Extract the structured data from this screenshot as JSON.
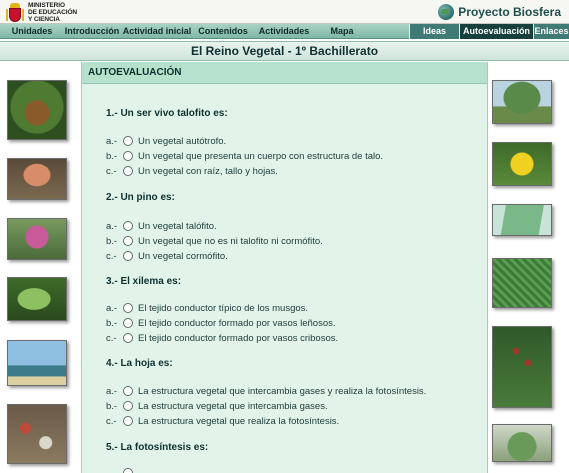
{
  "header": {
    "ministry_lines": [
      "MINISTERIO",
      "DE EDUCACIÓN",
      "Y CIENCIA"
    ],
    "brand": "Proyecto Biosfera"
  },
  "nav": {
    "items": [
      "Unidades",
      "Introducción",
      "Actividad inicial",
      "Contenidos",
      "Actividades",
      "Mapa"
    ],
    "right_items": [
      "Ideas",
      "Autoevaluación",
      "Enlaces"
    ],
    "active": "Autoevaluación"
  },
  "page_title": "El Reino Vegetal   -   1º Bachillerato",
  "section_title": "AUTOEVALUACIÓN",
  "questions": [
    {
      "text": "1.- Un ser vivo talofito es:",
      "options": [
        {
          "letter": "a.-",
          "text": "Un vegetal autótrofo."
        },
        {
          "letter": "b.-",
          "text": "Un vegetal que presenta un cuerpo con estructura de talo."
        },
        {
          "letter": "c.-",
          "text": "Un vegetal con raíz, tallo y hojas."
        }
      ]
    },
    {
      "text": "2.- Un pino es:",
      "options": [
        {
          "letter": "a.-",
          "text": "Un vegetal talófito."
        },
        {
          "letter": "b.-",
          "text": "Un vegetal que no es ni talofito ni cormófito."
        },
        {
          "letter": "c.-",
          "text": "Un vegetal cormófito."
        }
      ]
    },
    {
      "text": "3.- El xilema es:",
      "options": [
        {
          "letter": "a.-",
          "text": "El tejido conductor típico de los musgos."
        },
        {
          "letter": "b.-",
          "text": "El tejido conductor formado por vasos leñosos."
        },
        {
          "letter": "c.-",
          "text": "El tejido conductor formado por vasos cribosos."
        }
      ]
    },
    {
      "text": "4.- La hoja es:",
      "options": [
        {
          "letter": "a.-",
          "text": "La estructura vegetal que intercambia gases y realiza la fotosíntesis."
        },
        {
          "letter": "b.-",
          "text": "La estructura vegetal que intercambia gases."
        },
        {
          "letter": "c.-",
          "text": "La estructura vegetal que realiza la fotosíntesis."
        }
      ]
    },
    {
      "text": "5.- La fotosíntesis es:",
      "options": []
    }
  ],
  "left_images": [
    "pine-cone-photo",
    "mushroom-photo",
    "thistle-flower-photo",
    "plant-leaf-photo",
    "palm-trees-photo",
    "lichen-photo"
  ],
  "right_images": [
    "tree-photo",
    "yellow-flower-photo",
    "microscope-cells-photo",
    "fern-photo",
    "moss-sporophytes-photo",
    "moss-photo"
  ],
  "colors": {
    "nav_bar": "#8fc4b2",
    "nav_dark": "#3f7a74",
    "nav_active": "#173f3c",
    "content_bg": "#e2f4ea",
    "section_header_bg": "#b5e1cd",
    "brand_text": "#1f4f4c"
  }
}
